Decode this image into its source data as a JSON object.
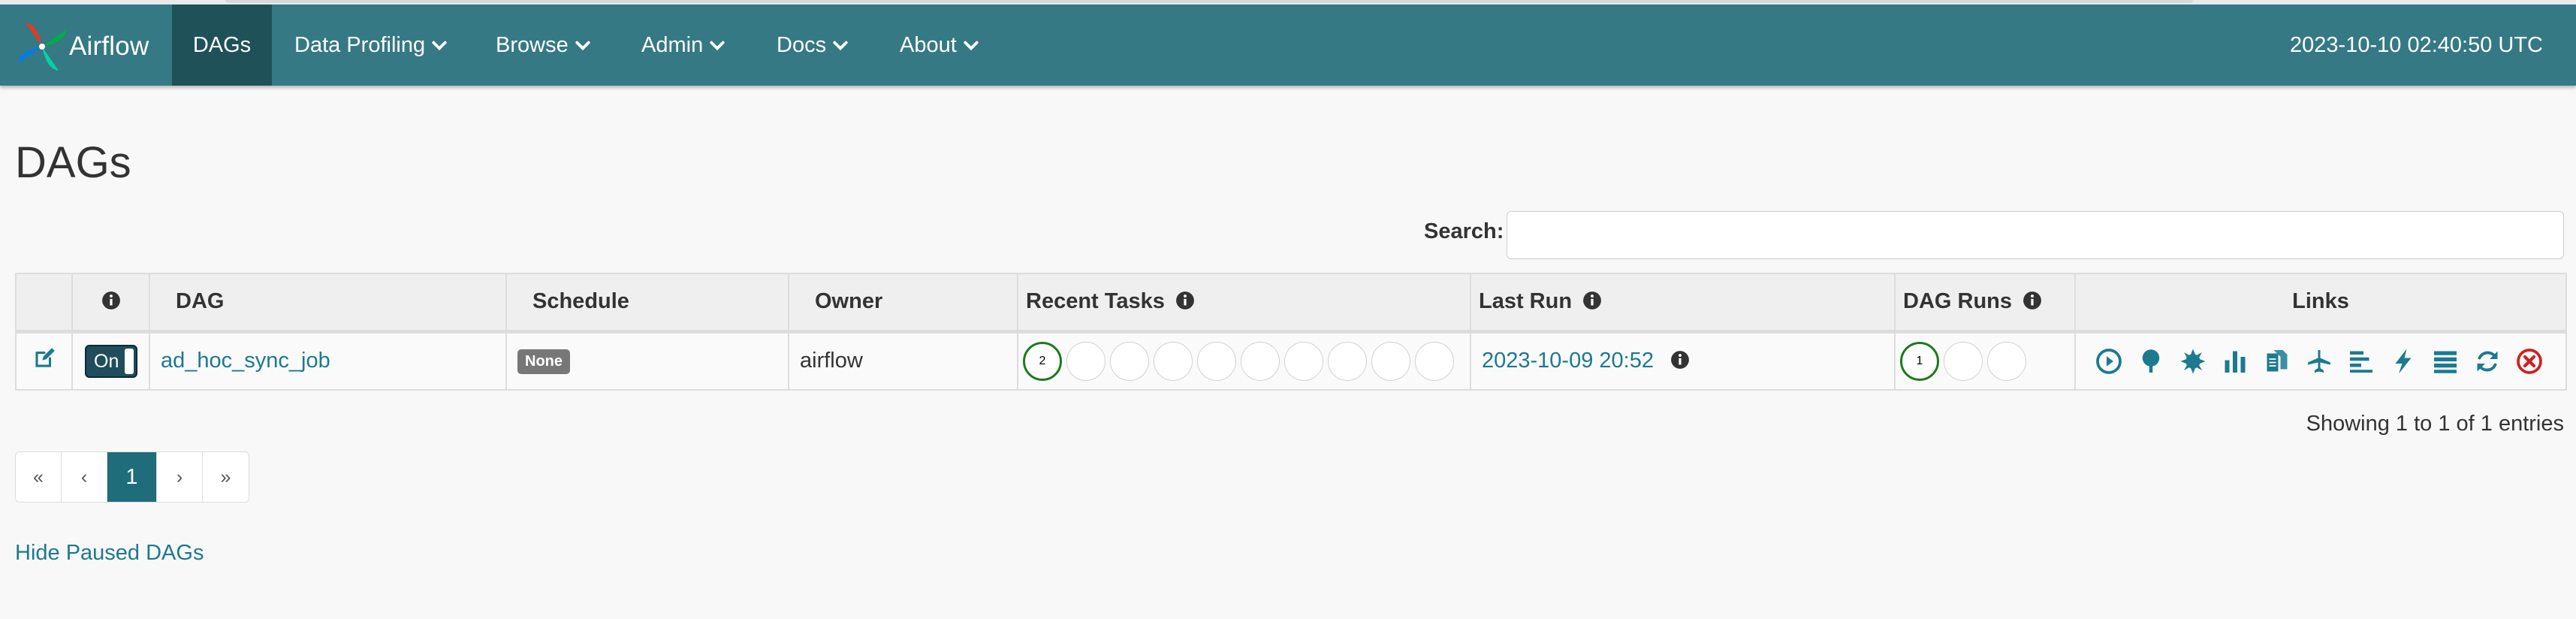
{
  "navbar": {
    "brand": "Airflow",
    "items": [
      {
        "label": "DAGs",
        "active": true,
        "dropdown": false
      },
      {
        "label": "Data Profiling",
        "active": false,
        "dropdown": true
      },
      {
        "label": "Browse",
        "active": false,
        "dropdown": true
      },
      {
        "label": "Admin",
        "active": false,
        "dropdown": true
      },
      {
        "label": "Docs",
        "active": false,
        "dropdown": true
      },
      {
        "label": "About",
        "active": false,
        "dropdown": true
      }
    ],
    "timestamp": "2023-10-10 02:40:50 UTC"
  },
  "page": {
    "title": "DAGs"
  },
  "search": {
    "label": "Search:",
    "value": ""
  },
  "table": {
    "headers": {
      "info": "info-icon",
      "dag": "DAG",
      "schedule": "Schedule",
      "owner": "Owner",
      "recent_tasks": "Recent Tasks",
      "last_run": "Last Run",
      "dag_runs": "DAG Runs",
      "links": "Links"
    },
    "rows": [
      {
        "toggle": "On",
        "dag": "ad_hoc_sync_job",
        "schedule": "None",
        "owner": "airflow",
        "recent_tasks": [
          "2",
          "",
          "",
          "",
          "",
          "",
          "",
          "",
          "",
          ""
        ],
        "last_run": "2023-10-09 20:52",
        "dag_runs": [
          "1",
          "",
          ""
        ]
      }
    ],
    "link_icons": [
      "trigger-dag-icon",
      "tree-view-icon",
      "graph-view-icon",
      "tries-icon",
      "landing-times-icon",
      "task-duration-icon",
      "gantt-icon",
      "code-icon",
      "logs-icon",
      "refresh-icon",
      "delete-icon"
    ]
  },
  "pagination": {
    "first": "«",
    "prev": "‹",
    "current": "1",
    "next": "›",
    "last": "»"
  },
  "summary": "Showing 1 to 1 of 1 entries",
  "hide_paused": "Hide Paused DAGs",
  "colors": {
    "navbar": "#357984",
    "active_nav": "#1f5159",
    "link": "#1b7a90",
    "success": "#1d7a1d",
    "delete": "#cc2222"
  }
}
